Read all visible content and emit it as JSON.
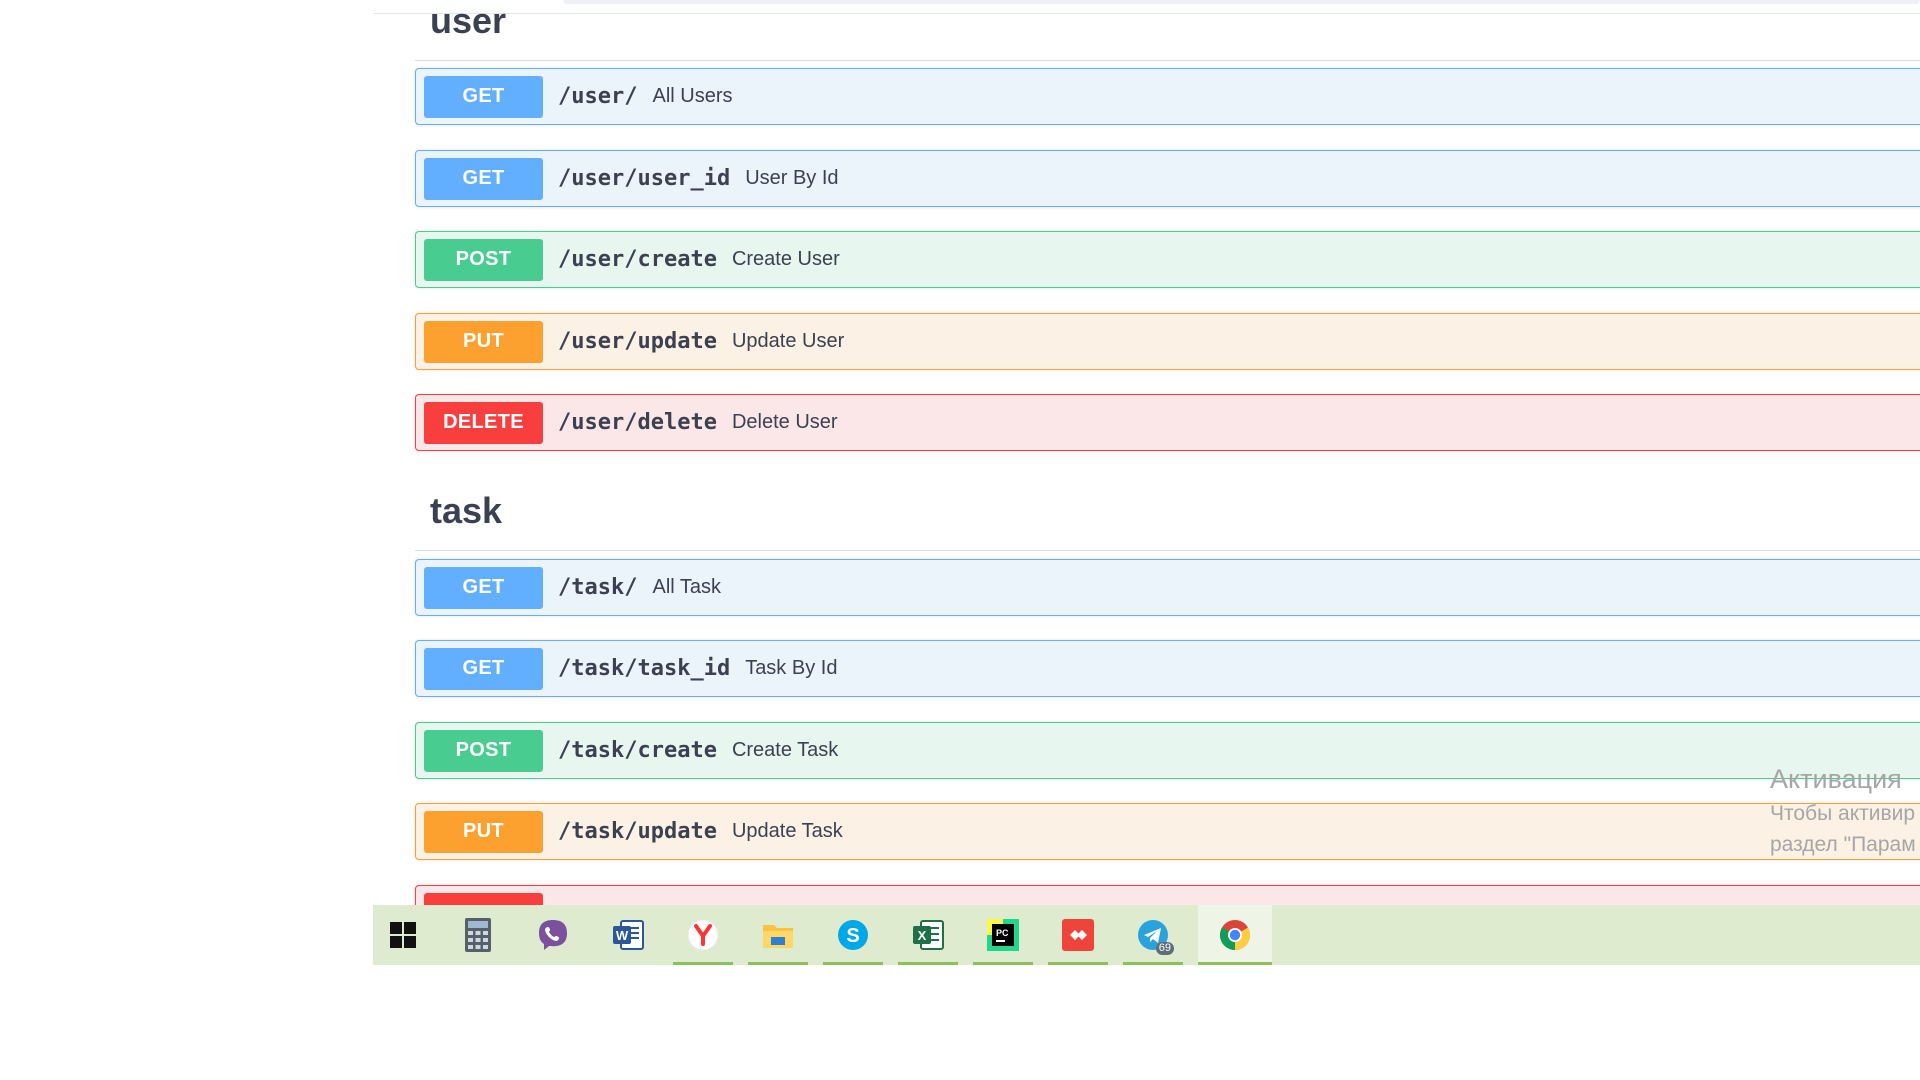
{
  "sections": [
    {
      "title": "user",
      "operations": [
        {
          "method": "GET",
          "path": "/user/",
          "summary": "All Users"
        },
        {
          "method": "GET",
          "path": "/user/user_id",
          "summary": "User By Id"
        },
        {
          "method": "POST",
          "path": "/user/create",
          "summary": "Create User"
        },
        {
          "method": "PUT",
          "path": "/user/update",
          "summary": "Update User"
        },
        {
          "method": "DELETE",
          "path": "/user/delete",
          "summary": "Delete User"
        }
      ]
    },
    {
      "title": "task",
      "operations": [
        {
          "method": "GET",
          "path": "/task/",
          "summary": "All Task"
        },
        {
          "method": "GET",
          "path": "/task/task_id",
          "summary": "Task By Id"
        },
        {
          "method": "POST",
          "path": "/task/create",
          "summary": "Create Task"
        },
        {
          "method": "PUT",
          "path": "/task/update",
          "summary": "Update Task"
        },
        {
          "method": "",
          "path": "",
          "summary": ""
        }
      ]
    }
  ],
  "watermark": {
    "line1": "Активация",
    "line2": "Чтобы активир",
    "line3": "раздел \"Парам"
  },
  "taskbar": {
    "telegram_badge": "69",
    "apps": [
      "start",
      "calculator",
      "viber",
      "word",
      "yandex-browser",
      "file-explorer",
      "skype",
      "excel",
      "pycharm",
      "anydesk",
      "telegram",
      "chrome"
    ]
  },
  "colors": {
    "get": "#61affe",
    "post": "#49cc90",
    "put": "#fca130",
    "delete": "#f93e3e",
    "taskbar": "#dfebcf"
  }
}
